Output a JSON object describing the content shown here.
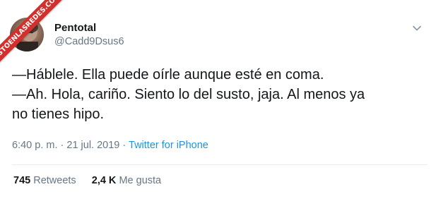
{
  "watermark": {
    "text": "VISTOENLASREDES.COM",
    "color": "#d2302c"
  },
  "tweet": {
    "display_name": "Pentotal",
    "handle": "@Cadd9Dsus6",
    "text_lines": [
      "—Háblele. Ella puede oírle aunque esté en coma.",
      "—Ah. Hola, cariño. Siento lo del susto, jaja. Al menos ya",
      "no tienes hipo."
    ],
    "time": "6:40 p. m.",
    "separator": "·",
    "date": "21 jul. 2019",
    "source": "Twitter for iPhone",
    "retweets_count": "745",
    "retweets_label": "Retweets",
    "likes_count": "2,4 K",
    "likes_label": "Me gusta",
    "menu_icon": "chevron-down-icon"
  },
  "colors": {
    "text": "#14171a",
    "secondary": "#657786",
    "link": "#1b95e0",
    "divider": "#e6ecf0"
  }
}
